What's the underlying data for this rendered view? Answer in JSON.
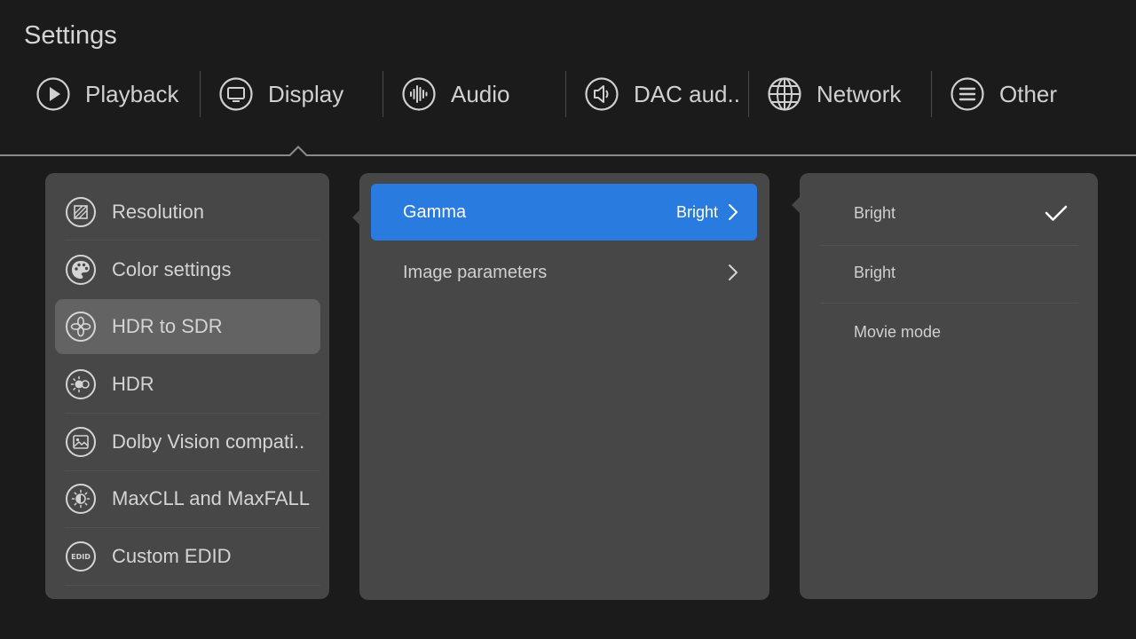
{
  "header": {
    "title": "Settings"
  },
  "tabs": [
    {
      "label": "Playback",
      "icon": "play-circle-icon"
    },
    {
      "label": "Display",
      "icon": "monitor-icon"
    },
    {
      "label": "Audio",
      "icon": "soundwave-icon"
    },
    {
      "label": "DAC aud..",
      "icon": "speaker-icon"
    },
    {
      "label": "Network",
      "icon": "globe-icon"
    },
    {
      "label": "Other",
      "icon": "menu-lines-icon"
    }
  ],
  "display_menu": {
    "selected_index": 2,
    "items": [
      {
        "label": "Resolution",
        "icon": "resolution-icon"
      },
      {
        "label": "Color settings",
        "icon": "palette-icon"
      },
      {
        "label": "HDR to SDR",
        "icon": "hdr-to-sdr-icon"
      },
      {
        "label": "HDR",
        "icon": "hdr-icon"
      },
      {
        "label": "Dolby Vision compati..",
        "icon": "image-icon"
      },
      {
        "label": "MaxCLL and MaxFALL",
        "icon": "brightness-icon"
      },
      {
        "label": "Custom EDID",
        "icon": "edid-icon",
        "icon_text": "EDID"
      }
    ]
  },
  "submenu": {
    "rows": [
      {
        "label": "Gamma",
        "value": "Bright",
        "active": true
      },
      {
        "label": "Image parameters",
        "value": "",
        "active": false
      }
    ]
  },
  "options": {
    "items": [
      {
        "label": "Bright",
        "checked": true
      },
      {
        "label": "Bright",
        "checked": false
      },
      {
        "label": "Movie mode",
        "checked": false
      }
    ]
  },
  "colors": {
    "background": "#1b1b1b",
    "panel": "#474747",
    "selected_item": "#636363",
    "accent": "#2a7be0"
  }
}
